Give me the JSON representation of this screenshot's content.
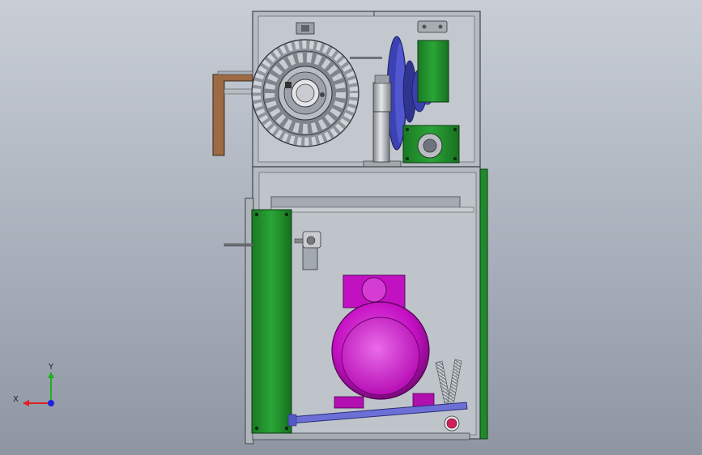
{
  "viewport": {
    "background_top": "#c9ced6",
    "background_bottom": "#8e96a3"
  },
  "colors": {
    "frame": "#bcc1c8",
    "frame_edge": "#444a52",
    "panel_green": "#1f8a2a",
    "motor_magenta": "#d014cf",
    "reel_gray": "#9aa0a6",
    "flywheel_blue": "#3d43b8",
    "slide_blue": "#6c6fd6",
    "copper": "#9a6a45",
    "knob_red": "#d0205a"
  },
  "triad": {
    "x_label": "X",
    "y_label": "Y",
    "x_color": "#e02020",
    "y_color": "#20b020",
    "z_color": "#2020e0"
  },
  "parts": [
    "upper-cabinet",
    "wire-spool",
    "drive-flywheel",
    "green-motor-bracket",
    "lower-cabinet",
    "left-access-door",
    "electric-motor",
    "tension-springs",
    "base-slide-rail"
  ]
}
